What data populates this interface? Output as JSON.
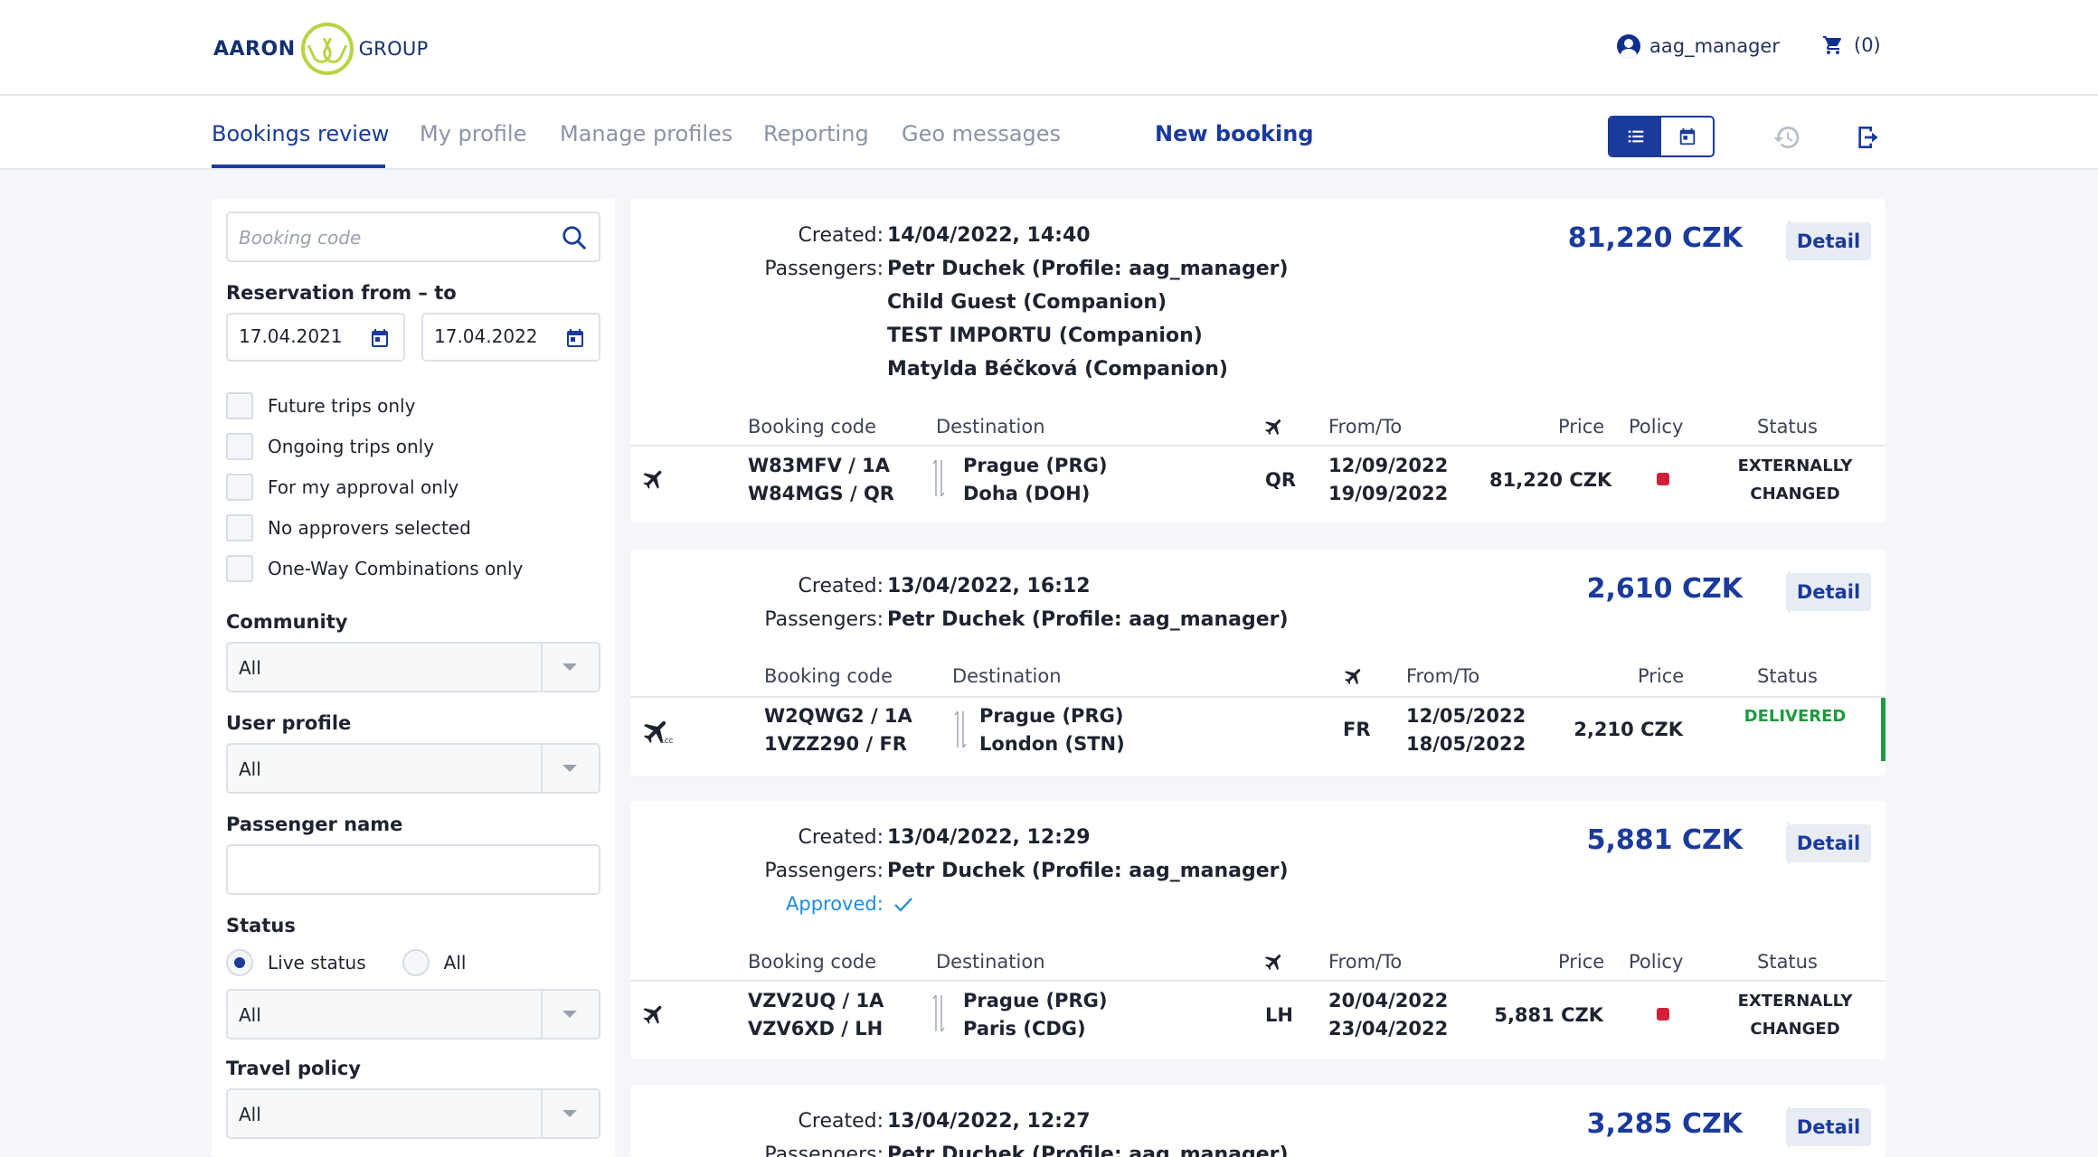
{
  "header": {
    "logo_left": "AARON",
    "logo_right": "GROUP",
    "username": "aag_manager",
    "cart_count": "(0)"
  },
  "nav": {
    "tabs": [
      {
        "label": "Bookings review",
        "active": true
      },
      {
        "label": "My profile"
      },
      {
        "label": "Manage profiles"
      },
      {
        "label": "Reporting"
      },
      {
        "label": "Geo messages"
      }
    ],
    "new_booking": "New booking",
    "icons": [
      "list-view-icon",
      "calendar-view-icon",
      "history-icon",
      "logout-icon"
    ]
  },
  "filters": {
    "booking_code_placeholder": "Booking code",
    "reservation_label": "Reservation from – to",
    "date_from": "17.04.2021",
    "date_to": "17.04.2022",
    "checkboxes": [
      "Future trips only",
      "Ongoing trips only",
      "For my approval only",
      "No approvers selected",
      "One-Way Combinations only"
    ],
    "community_label": "Community",
    "community_value": "All",
    "user_profile_label": "User profile",
    "user_profile_value": "All",
    "passenger_name_label": "Passenger name",
    "status_label": "Status",
    "status_radio_live": "Live status",
    "status_radio_all": "All",
    "status_value": "All",
    "travel_policy_label": "Travel policy",
    "travel_policy_value": "All"
  },
  "columns": {
    "booking_code": "Booking code",
    "destination": "Destination",
    "from_to": "From/To",
    "price": "Price",
    "policy": "Policy",
    "status": "Status"
  },
  "labels": {
    "created": "Created:",
    "passengers": "Passengers:",
    "approved": "Approved:",
    "detail": "Detail"
  },
  "bookings": [
    {
      "created": "14/04/2022, 14:40",
      "total": "81,220 CZK",
      "passengers": [
        "Petr Duchek (Profile: aag_manager)",
        "Child Guest (Companion)",
        "TEST IMPORTU (Companion)",
        "Matylda Béčková (Companion)"
      ],
      "code_1": "W83MFV / 1A",
      "code_2": "W84MGS / QR",
      "dest_1": "Prague (PRG)",
      "dest_2": "Doha (DOH)",
      "airline": "QR",
      "date_1": "12/09/2022",
      "date_2": "19/09/2022",
      "price": "81,220 CZK",
      "status_1": "EXTERNALLY",
      "status_2": "CHANGED"
    },
    {
      "created": "13/04/2022, 16:12",
      "total": "2,610 CZK",
      "passengers": [
        "Petr Duchek (Profile: aag_manager)"
      ],
      "code_1": "W2QWG2 / 1A",
      "code_2": "1VZZ290 / FR",
      "dest_1": "Prague (PRG)",
      "dest_2": "London (STN)",
      "airline": "FR",
      "date_1": "12/05/2022",
      "date_2": "18/05/2022",
      "price": "2,210 CZK",
      "status_1": "DELIVERED",
      "status_color": "#1c9b3d",
      "plane_badge": "LCC"
    },
    {
      "created": "13/04/2022, 12:29",
      "total": "5,881 CZK",
      "passengers": [
        "Petr Duchek (Profile: aag_manager)"
      ],
      "code_1": "VZV2UQ / 1A",
      "code_2": "VZV6XD / LH",
      "dest_1": "Prague (PRG)",
      "dest_2": "Paris (CDG)",
      "airline": "LH",
      "date_1": "20/04/2022",
      "date_2": "23/04/2022",
      "price": "5,881 CZK",
      "status_1": "EXTERNALLY",
      "status_2": "CHANGED"
    },
    {
      "created": "13/04/2022, 12:27",
      "total": "3,285 CZK",
      "passengers": [
        "Petr Duchek (Profile: aag_manager)"
      ]
    }
  ],
  "colors": {
    "brand": "#1a3a9c",
    "logo_green": "#b6d442",
    "policy_violation": "#d3203a",
    "delivered": "#1c9b3d",
    "approved": "#1e8be0"
  }
}
